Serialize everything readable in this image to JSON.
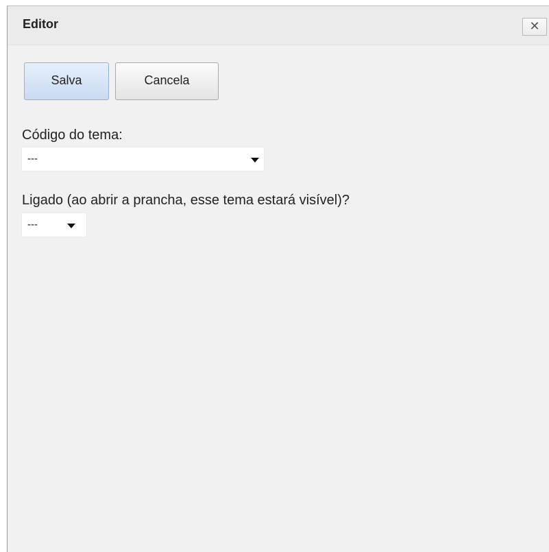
{
  "dialog": {
    "title": "Editor",
    "close_symbol": "✕",
    "close_icon": "close-icon"
  },
  "buttons": {
    "save_label": "Salva",
    "cancel_label": "Cancela"
  },
  "form": {
    "theme_code": {
      "label": "Código do tema:",
      "selected": "---"
    },
    "enabled": {
      "label": "Ligado (ao abrir a prancha, esse tema estará visível)?",
      "selected": "---"
    }
  },
  "colors": {
    "save_button_bg": "#c9dbf3",
    "dialog_bg": "#f1f1f1"
  }
}
